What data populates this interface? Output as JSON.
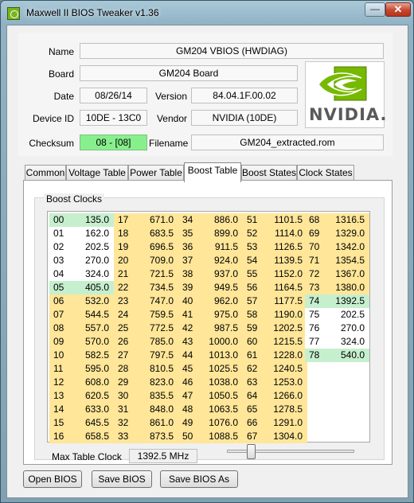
{
  "window": {
    "title": "Maxwell II BIOS Tweaker v1.36",
    "minimize_glyph": "—",
    "close_glyph": "✕"
  },
  "info": {
    "name_label": "Name",
    "name_value": "GM204 VBIOS (HWDIAG)",
    "board_label": "Board",
    "board_value": "GM204 Board",
    "date_label": "Date",
    "date_value": "08/26/14",
    "version_label": "Version",
    "version_value": "84.04.1F.00.02",
    "device_label": "Device ID",
    "device_value": "10DE - 13C0",
    "vendor_label": "Vendor",
    "vendor_value": "NVIDIA (10DE)",
    "checksum_label": "Checksum",
    "checksum_value": "08 - [08]",
    "filename_label": "Filename",
    "filename_value": "GM204_extracted.rom"
  },
  "logo": {
    "wordmark": "NVIDIA.",
    "brand_color": "#76b900"
  },
  "tabs": [
    {
      "label": "Common"
    },
    {
      "label": "Voltage Table"
    },
    {
      "label": "Power Table"
    },
    {
      "label": "Boost Table"
    },
    {
      "label": "Boost States"
    },
    {
      "label": "Clock States"
    }
  ],
  "active_tab": "Boost Table",
  "boost": {
    "group_title": "Boost Clocks",
    "max_label": "Max Table Clock",
    "max_value": "1392.5 MHz",
    "slider_fraction": 0.17,
    "colors": {
      "yellow": "#ffe699",
      "green": "#c6efce",
      "white": "#ffffff"
    },
    "columns": [
      [
        {
          "i": "00",
          "v": "135.0",
          "c": "green"
        },
        {
          "i": "01",
          "v": "162.0",
          "c": "white"
        },
        {
          "i": "02",
          "v": "202.5",
          "c": "white"
        },
        {
          "i": "03",
          "v": "270.0",
          "c": "white"
        },
        {
          "i": "04",
          "v": "324.0",
          "c": "white"
        },
        {
          "i": "05",
          "v": "405.0",
          "c": "green"
        },
        {
          "i": "06",
          "v": "532.0",
          "c": "yellow"
        },
        {
          "i": "07",
          "v": "544.5",
          "c": "yellow"
        },
        {
          "i": "08",
          "v": "557.0",
          "c": "yellow"
        },
        {
          "i": "09",
          "v": "570.0",
          "c": "yellow"
        },
        {
          "i": "10",
          "v": "582.5",
          "c": "yellow"
        },
        {
          "i": "11",
          "v": "595.0",
          "c": "yellow"
        },
        {
          "i": "12",
          "v": "608.0",
          "c": "yellow"
        },
        {
          "i": "13",
          "v": "620.5",
          "c": "yellow"
        },
        {
          "i": "14",
          "v": "633.0",
          "c": "yellow"
        },
        {
          "i": "15",
          "v": "645.5",
          "c": "yellow"
        },
        {
          "i": "16",
          "v": "658.5",
          "c": "yellow"
        }
      ],
      [
        {
          "i": "17",
          "v": "671.0",
          "c": "yellow"
        },
        {
          "i": "18",
          "v": "683.5",
          "c": "yellow"
        },
        {
          "i": "19",
          "v": "696.5",
          "c": "yellow"
        },
        {
          "i": "20",
          "v": "709.0",
          "c": "yellow"
        },
        {
          "i": "21",
          "v": "721.5",
          "c": "yellow"
        },
        {
          "i": "22",
          "v": "734.5",
          "c": "yellow"
        },
        {
          "i": "23",
          "v": "747.0",
          "c": "yellow"
        },
        {
          "i": "24",
          "v": "759.5",
          "c": "yellow"
        },
        {
          "i": "25",
          "v": "772.5",
          "c": "yellow"
        },
        {
          "i": "26",
          "v": "785.0",
          "c": "yellow"
        },
        {
          "i": "27",
          "v": "797.5",
          "c": "yellow"
        },
        {
          "i": "28",
          "v": "810.5",
          "c": "yellow"
        },
        {
          "i": "29",
          "v": "823.0",
          "c": "yellow"
        },
        {
          "i": "30",
          "v": "835.5",
          "c": "yellow"
        },
        {
          "i": "31",
          "v": "848.0",
          "c": "yellow"
        },
        {
          "i": "32",
          "v": "861.0",
          "c": "yellow"
        },
        {
          "i": "33",
          "v": "873.5",
          "c": "yellow"
        }
      ],
      [
        {
          "i": "34",
          "v": "886.0",
          "c": "yellow"
        },
        {
          "i": "35",
          "v": "899.0",
          "c": "yellow"
        },
        {
          "i": "36",
          "v": "911.5",
          "c": "yellow"
        },
        {
          "i": "37",
          "v": "924.0",
          "c": "yellow"
        },
        {
          "i": "38",
          "v": "937.0",
          "c": "yellow"
        },
        {
          "i": "39",
          "v": "949.5",
          "c": "yellow"
        },
        {
          "i": "40",
          "v": "962.0",
          "c": "yellow"
        },
        {
          "i": "41",
          "v": "975.0",
          "c": "yellow"
        },
        {
          "i": "42",
          "v": "987.5",
          "c": "yellow"
        },
        {
          "i": "43",
          "v": "1000.0",
          "c": "yellow"
        },
        {
          "i": "44",
          "v": "1013.0",
          "c": "yellow"
        },
        {
          "i": "45",
          "v": "1025.5",
          "c": "yellow"
        },
        {
          "i": "46",
          "v": "1038.0",
          "c": "yellow"
        },
        {
          "i": "47",
          "v": "1050.5",
          "c": "yellow"
        },
        {
          "i": "48",
          "v": "1063.5",
          "c": "yellow"
        },
        {
          "i": "49",
          "v": "1076.0",
          "c": "yellow"
        },
        {
          "i": "50",
          "v": "1088.5",
          "c": "yellow"
        }
      ],
      [
        {
          "i": "51",
          "v": "1101.5",
          "c": "yellow"
        },
        {
          "i": "52",
          "v": "1114.0",
          "c": "yellow"
        },
        {
          "i": "53",
          "v": "1126.5",
          "c": "yellow"
        },
        {
          "i": "54",
          "v": "1139.5",
          "c": "yellow"
        },
        {
          "i": "55",
          "v": "1152.0",
          "c": "yellow"
        },
        {
          "i": "56",
          "v": "1164.5",
          "c": "yellow"
        },
        {
          "i": "57",
          "v": "1177.5",
          "c": "yellow"
        },
        {
          "i": "58",
          "v": "1190.0",
          "c": "yellow"
        },
        {
          "i": "59",
          "v": "1202.5",
          "c": "yellow"
        },
        {
          "i": "60",
          "v": "1215.5",
          "c": "yellow"
        },
        {
          "i": "61",
          "v": "1228.0",
          "c": "yellow"
        },
        {
          "i": "62",
          "v": "1240.5",
          "c": "yellow"
        },
        {
          "i": "63",
          "v": "1253.0",
          "c": "yellow"
        },
        {
          "i": "64",
          "v": "1266.0",
          "c": "yellow"
        },
        {
          "i": "65",
          "v": "1278.5",
          "c": "yellow"
        },
        {
          "i": "66",
          "v": "1291.0",
          "c": "yellow"
        },
        {
          "i": "67",
          "v": "1304.0",
          "c": "yellow"
        }
      ],
      [
        {
          "i": "68",
          "v": "1316.5",
          "c": "yellow"
        },
        {
          "i": "69",
          "v": "1329.0",
          "c": "yellow"
        },
        {
          "i": "70",
          "v": "1342.0",
          "c": "yellow"
        },
        {
          "i": "71",
          "v": "1354.5",
          "c": "yellow"
        },
        {
          "i": "72",
          "v": "1367.0",
          "c": "yellow"
        },
        {
          "i": "73",
          "v": "1380.0",
          "c": "yellow"
        },
        {
          "i": "74",
          "v": "1392.5",
          "c": "green"
        },
        {
          "i": "75",
          "v": "202.5",
          "c": "white"
        },
        {
          "i": "76",
          "v": "270.0",
          "c": "white"
        },
        {
          "i": "77",
          "v": "324.0",
          "c": "white"
        },
        {
          "i": "78",
          "v": "540.0",
          "c": "green"
        }
      ]
    ]
  },
  "buttons": {
    "open": "Open BIOS",
    "save": "Save BIOS",
    "save_as": "Save BIOS As"
  }
}
